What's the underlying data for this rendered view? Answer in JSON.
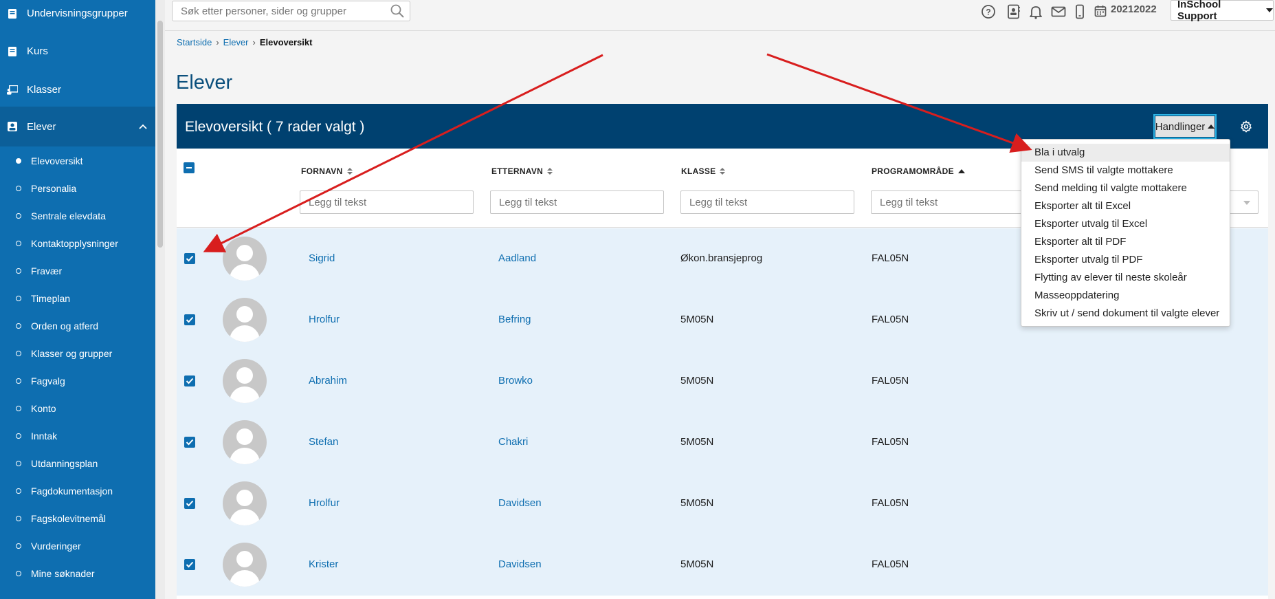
{
  "sidebar": {
    "main_items": [
      {
        "label": "Undervisningsgrupper",
        "icon": "book-icon"
      },
      {
        "label": "Kurs",
        "icon": "book-icon"
      },
      {
        "label": "Klasser",
        "icon": "classroom-icon"
      },
      {
        "label": "Elever",
        "icon": "student-icon"
      }
    ],
    "sub_items": [
      "Elevoversikt",
      "Personalia",
      "Sentrale elevdata",
      "Kontaktopplysninger",
      "Fravær",
      "Timeplan",
      "Orden og atferd",
      "Klasser og grupper",
      "Fagvalg",
      "Konto",
      "Inntak",
      "Utdanningsplan",
      "Fagdokumentasjon",
      "Fagskolevitnemål",
      "Vurderinger",
      "Mine søknader"
    ],
    "active_sub": "Elevoversikt",
    "colors": {
      "background": "#0e6eb0"
    }
  },
  "topbar": {
    "search_placeholder": "Søk etter personer, sider og grupper",
    "icons": [
      "help-icon",
      "contact-card-icon",
      "bell-icon",
      "mail-icon",
      "mobile-icon",
      "calendar-icon"
    ],
    "school_year": "20212022",
    "user_menu": "InSchool Support"
  },
  "breadcrumb": {
    "items": [
      "Startside",
      "Elever"
    ],
    "current": "Elevoversikt"
  },
  "page": {
    "title": "Elever",
    "panel_title": "Elevoversikt ( 7 rader valgt )",
    "actions_label": "Handlinger",
    "colors": {
      "header": "#004170",
      "row_selected": "#e6f1fa",
      "link": "#0e6eb0"
    }
  },
  "table": {
    "columns": [
      "FORNAVN",
      "ETTERNAVN",
      "KLASSE",
      "PROGRAMOMRÅDE"
    ],
    "filter_placeholder": "Legg til tekst",
    "rows": [
      {
        "fornavn": "Sigrid",
        "etternavn": "Aadland",
        "klasse": "Økon.bransjeprog",
        "program": "FAL05N",
        "selected": true
      },
      {
        "fornavn": "Hrolfur",
        "etternavn": "Befring",
        "klasse": "5M05N",
        "program": "FAL05N",
        "selected": true
      },
      {
        "fornavn": "Abrahim",
        "etternavn": "Browko",
        "klasse": "5M05N",
        "program": "FAL05N",
        "selected": true
      },
      {
        "fornavn": "Stefan",
        "etternavn": "Chakri",
        "klasse": "5M05N",
        "program": "FAL05N",
        "selected": true
      },
      {
        "fornavn": "Hrolfur",
        "etternavn": "Davidsen",
        "klasse": "5M05N",
        "program": "FAL05N",
        "selected": true
      },
      {
        "fornavn": "Krister",
        "etternavn": "Davidsen",
        "klasse": "5M05N",
        "program": "FAL05N",
        "selected": true
      }
    ]
  },
  "actions_menu": {
    "items": [
      "Bla i utvalg",
      "Send SMS til valgte mottakere",
      "Send melding til valgte mottakere",
      "Eksporter alt til Excel",
      "Eksporter utvalg til Excel",
      "Eksporter alt til PDF",
      "Eksporter utvalg til PDF",
      "Flytting av elever til neste skoleår",
      "Masseoppdatering",
      "Skriv ut / send dokument til valgte elever"
    ],
    "highlighted": "Bla i utvalg"
  },
  "annotation": {
    "arrow_color": "#d81e1e"
  }
}
